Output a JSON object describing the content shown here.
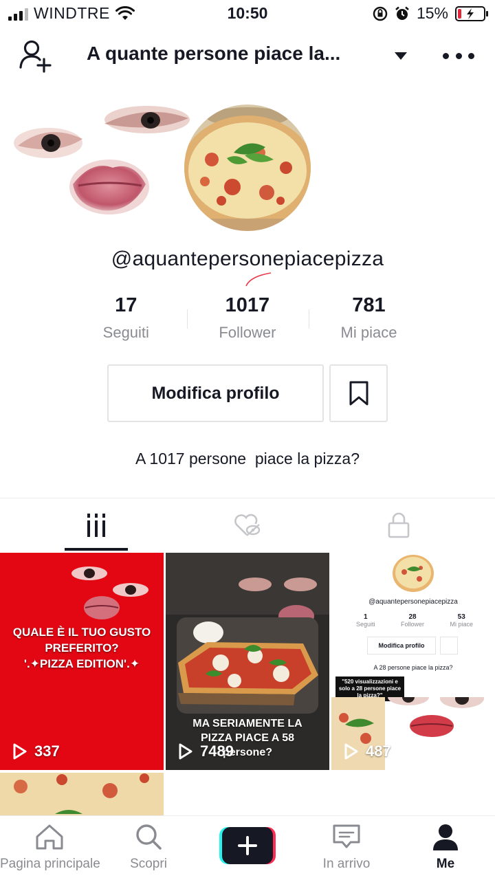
{
  "status_bar": {
    "carrier": "WINDTRE",
    "time": "10:50",
    "battery_percent": "15%",
    "battery_level": 0.15
  },
  "header": {
    "title": "A quante persone piace la...",
    "icons": [
      "add-user-icon",
      "chevron-down-icon",
      "more-icon"
    ]
  },
  "profile": {
    "username": "@aquantepersonepiacepizza",
    "stats": [
      {
        "value": "17",
        "label": "Seguiti"
      },
      {
        "value": "1017",
        "label": "Follower"
      },
      {
        "value": "781",
        "label": "Mi piace"
      }
    ],
    "edit_button": "Modifica profilo",
    "bio": "A 1017 persone  piace la pizza?"
  },
  "tabs": [
    {
      "icon": "grid-icon",
      "active": true
    },
    {
      "icon": "liked-hidden-icon",
      "active": false
    },
    {
      "icon": "lock-icon",
      "active": false
    }
  ],
  "videos": [
    {
      "views": "337",
      "caption_lines": [
        "QUALE È IL TUO GUSTO",
        "PREFERITO?",
        "'.✦PIZZA EDITION'.✦"
      ],
      "background": "#e30613"
    },
    {
      "views": "7489",
      "caption_lines": [
        "MA SERIAMENTE LA",
        "PIZZA PIACE A 58",
        "persone?"
      ],
      "background": "#2b2a28"
    },
    {
      "views": "487",
      "mini_profile": {
        "username": "@aquantepersonepiacepizza",
        "stats": [
          {
            "value": "1",
            "label": "Seguiti"
          },
          {
            "value": "28",
            "label": "Follower"
          },
          {
            "value": "53",
            "label": "Mi piace"
          }
        ],
        "edit_button": "Modifica profilo",
        "bio": "A 28 persone piace la pizza?",
        "sticker": "\"520 visualizzazioni e solo a 28 persone piace la pizza?\""
      }
    }
  ],
  "bottom_nav": [
    {
      "label": "Pagina principale",
      "icon": "home-icon",
      "active": false
    },
    {
      "label": "Scopri",
      "icon": "search-icon",
      "active": false
    },
    {
      "label": "",
      "icon": "plus-icon",
      "active": false
    },
    {
      "label": "In arrivo",
      "icon": "inbox-icon",
      "active": false
    },
    {
      "label": "Me",
      "icon": "profile-icon",
      "active": true
    }
  ],
  "colors": {
    "text": "#161823",
    "secondary_text": "#8a8b91",
    "border": "#e3e3e4",
    "accent_red": "#e30613",
    "create_cyan": "#25f4ee",
    "create_pink": "#fe2c55",
    "battery_low": "#e0273a"
  }
}
